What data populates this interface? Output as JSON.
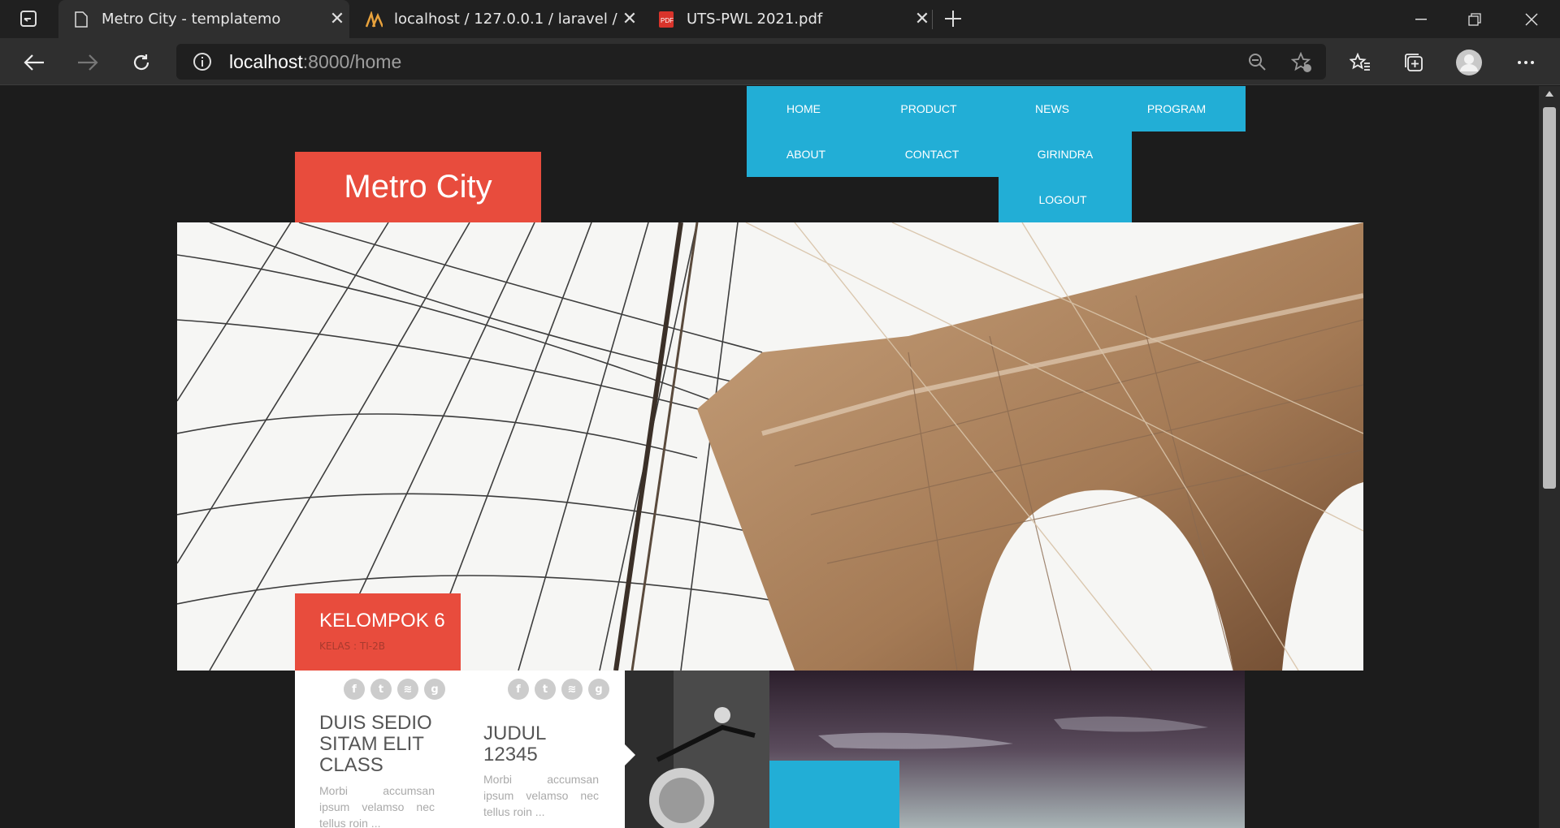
{
  "browser": {
    "tabs": [
      {
        "title": "Metro City - templatemo",
        "active": true
      },
      {
        "title": "localhost / 127.0.0.1 / laravel / us",
        "active": false
      },
      {
        "title": "UTS-PWL 2021.pdf",
        "active": false
      }
    ],
    "address": {
      "host": "localhost",
      "rest": ":8000/home"
    }
  },
  "nav": {
    "home": "HOME",
    "product": "PRODUCT",
    "news": "NEWS",
    "program": "PROGRAM",
    "about": "ABOUT",
    "contact": "CONTACT",
    "girindra": "GIRINDRA",
    "logout": "LOGOUT"
  },
  "brand": "Metro City",
  "hero_caption": {
    "title": "KELOMPOK 6",
    "subtitle": "KELAS : TI-2B"
  },
  "cards": [
    {
      "title": "DUIS SEDIO SITAM ELIT CLASS",
      "text": "Morbi accumsan ipsum velamso nec tellus roin ..."
    },
    {
      "title": "JUDUL 12345",
      "text": "Morbi accumsan ipsum velamso nec tellus roin ..."
    }
  ],
  "social_icons": [
    "facebook-icon",
    "twitter-icon",
    "rss-icon",
    "google-plus-icon"
  ],
  "colors": {
    "accent_red": "#e84c3d",
    "accent_blue": "#22aed6"
  }
}
